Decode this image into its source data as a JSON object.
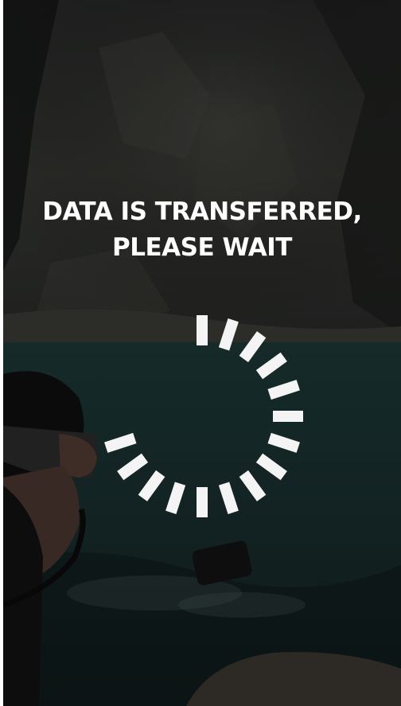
{
  "loading_screen": {
    "message_line1": "DATA IS TRANSFERRED,",
    "message_line2": "PLEASE WAIT",
    "progress": 0.75,
    "spinner_segments_total": 20,
    "colors": {
      "text": "#ffffff",
      "spinner": "#f4f4f4",
      "overlay": "#000000"
    },
    "background_image": "scuba diver at rocky lake shore"
  }
}
